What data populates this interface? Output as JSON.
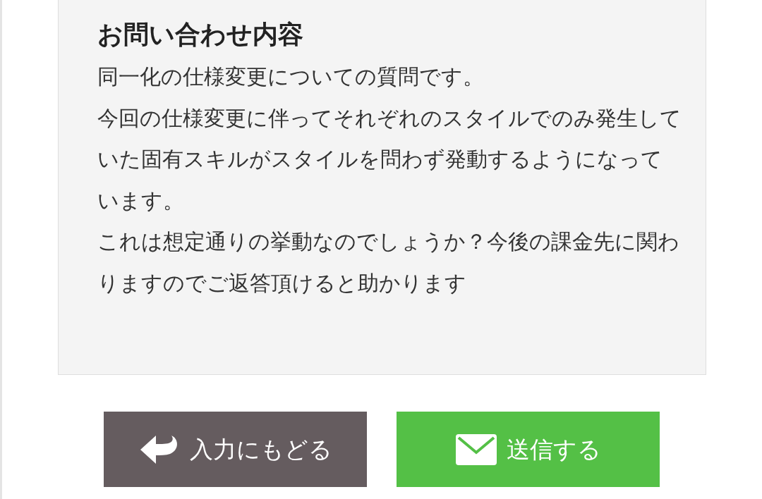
{
  "inquiry": {
    "title": "お問い合わせ内容",
    "paragraphs": [
      "同一化の仕様変更についての質問です。",
      "今回の仕様変更に伴ってそれぞれのスタイルでのみ発生していた固有スキルがスタイルを問わず発動するようになっています。",
      "これは想定通りの挙動なのでしょうか？今後の課金先に関わりますのでご返答頂けると助かります"
    ]
  },
  "buttons": [
    {
      "kind": "back",
      "label": "入力にもどる"
    },
    {
      "kind": "send",
      "label": "送信する"
    }
  ]
}
